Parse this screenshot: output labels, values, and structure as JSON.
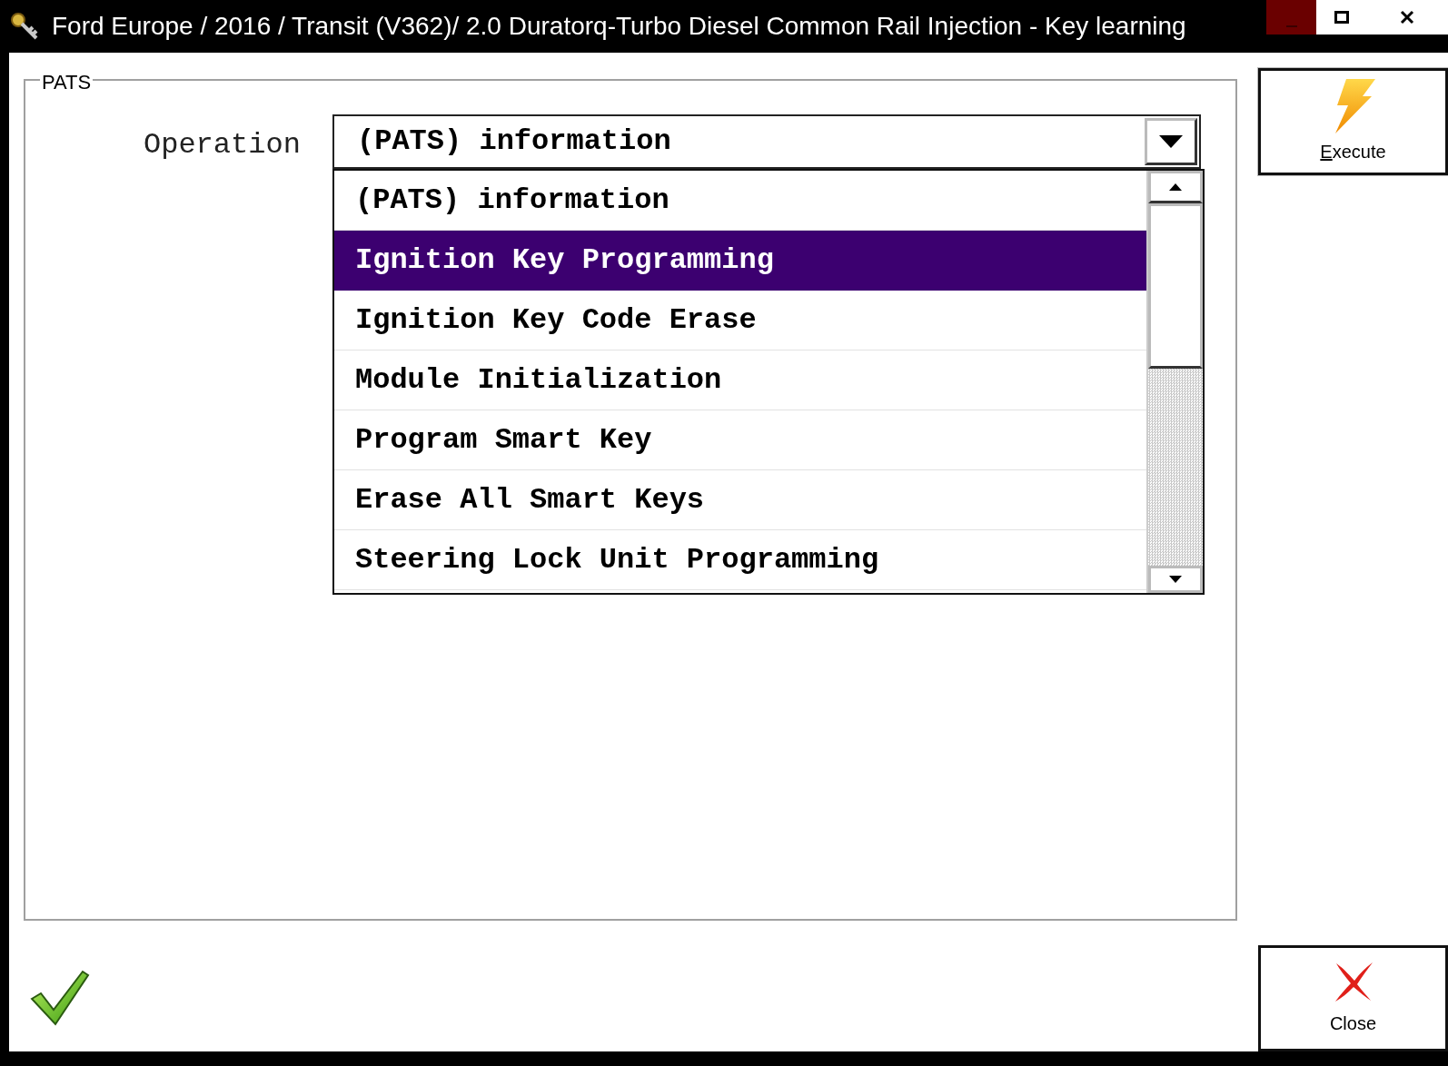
{
  "window": {
    "title": "Ford Europe / 2016 / Transit (V362)/ 2.0 Duratorq-Turbo Diesel Common Rail Injection - Key learning"
  },
  "group": {
    "title": "PATS"
  },
  "operation": {
    "label": "Operation",
    "value": "(PATS) information",
    "expanded": true,
    "options": [
      {
        "label": "(PATS) information",
        "highlighted": false
      },
      {
        "label": "Ignition Key Programming",
        "highlighted": true
      },
      {
        "label": "Ignition Key Code Erase",
        "highlighted": false
      },
      {
        "label": "Module Initialization",
        "highlighted": false
      },
      {
        "label": "Program Smart Key",
        "highlighted": false
      },
      {
        "label": "Erase All Smart Keys",
        "highlighted": false
      },
      {
        "label": "Steering Lock Unit Programming",
        "highlighted": false
      }
    ]
  },
  "buttons": [
    {
      "kind": "execute",
      "label": "Execute"
    },
    {
      "kind": "close",
      "label": "Close"
    }
  ]
}
